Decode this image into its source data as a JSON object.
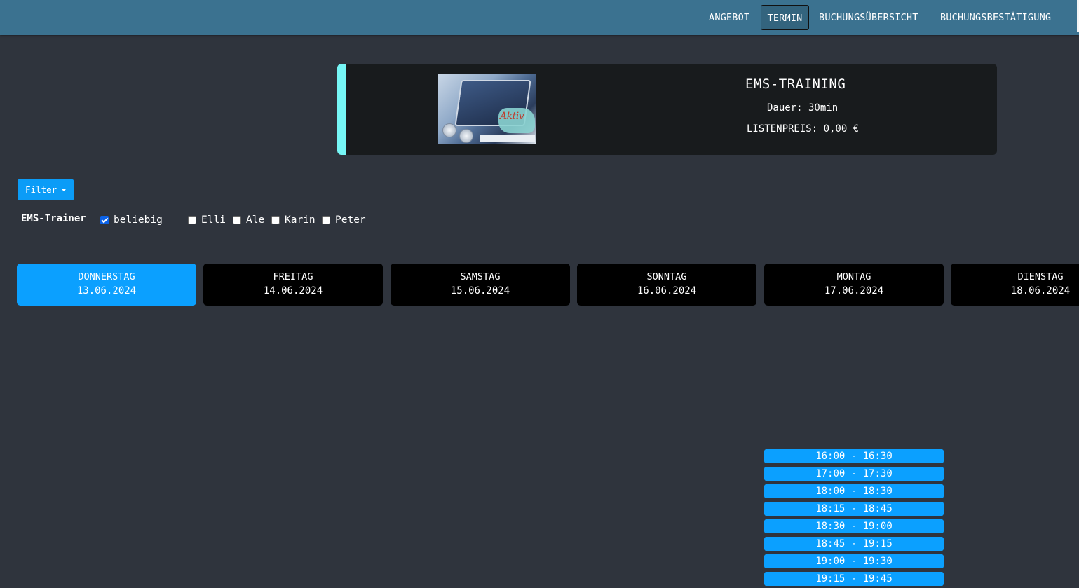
{
  "nav": {
    "items": [
      "ANGEBOT",
      "TERMIN",
      "BUCHUNGSÜBERSICHT",
      "BUCHUNGSBESTÄTIGUNG"
    ],
    "active": "TERMIN"
  },
  "product": {
    "title": "EMS-TRAINING",
    "duration": "Dauer: 30min",
    "price": "LISTENPREIS: 0,00 €",
    "image_logo_text": "Aktiv",
    "accent_color": "#76f6f6"
  },
  "filter": {
    "button_label": "Filter",
    "trainer_label": "EMS-Trainer",
    "options": [
      {
        "label": "beliebig",
        "checked": true
      },
      {
        "label": "Elli",
        "checked": false
      },
      {
        "label": "Ale",
        "checked": false
      },
      {
        "label": "Karin",
        "checked": false
      },
      {
        "label": "Peter",
        "checked": false
      }
    ]
  },
  "days": [
    {
      "name": "DONNERSTAG",
      "date": "13.06.2024",
      "active": true
    },
    {
      "name": "FREITAG",
      "date": "14.06.2024",
      "active": false
    },
    {
      "name": "SAMSTAG",
      "date": "15.06.2024",
      "active": false
    },
    {
      "name": "SONNTAG",
      "date": "16.06.2024",
      "active": false
    },
    {
      "name": "MONTAG",
      "date": "17.06.2024",
      "active": false
    },
    {
      "name": "DIENSTAG",
      "date": "18.06.2024",
      "active": false
    }
  ],
  "slots_day": "MONTAG",
  "slots": [
    "16:00 - 16:30",
    "17:00 - 17:30",
    "18:00 - 18:30",
    "18:15 - 18:45",
    "18:30 - 19:00",
    "18:45 - 19:15",
    "19:00 - 19:30",
    "19:15 - 19:45"
  ],
  "colors": {
    "header": "#3b7290",
    "background": "#2f343d",
    "primary": "#0ba0ff",
    "card": "#000000"
  }
}
